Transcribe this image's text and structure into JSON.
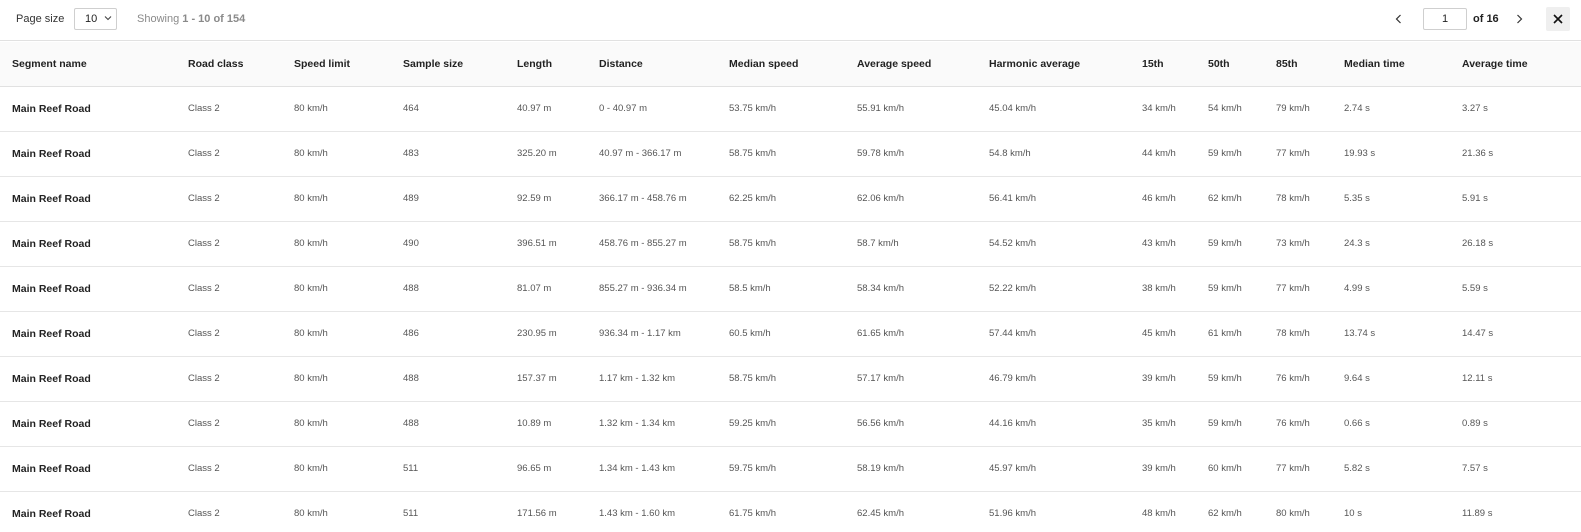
{
  "toolbar": {
    "page_size_label": "Page size",
    "page_size_value": "10",
    "showing_prefix": "Showing",
    "showing_range": "1 - 10 of 154",
    "current_page": "1",
    "of_pages": "of 16"
  },
  "icons": {
    "page_size_dropdown": "chevron-down-icon",
    "prev": "chevron-left-icon",
    "next": "chevron-right-icon",
    "close": "close-icon"
  },
  "table": {
    "columns": [
      "Segment name",
      "Road class",
      "Speed limit",
      "Sample size",
      "Length",
      "Distance",
      "Median speed",
      "Average speed",
      "Harmonic average",
      "15th",
      "50th",
      "85th",
      "Median time",
      "Average time"
    ],
    "rows": [
      [
        "Main Reef Road",
        "Class 2",
        "80 km/h",
        "464",
        "40.97 m",
        "0 - 40.97 m",
        "53.75 km/h",
        "55.91 km/h",
        "45.04 km/h",
        "34 km/h",
        "54 km/h",
        "79 km/h",
        "2.74 s",
        "3.27 s"
      ],
      [
        "Main Reef Road",
        "Class 2",
        "80 km/h",
        "483",
        "325.20 m",
        "40.97 m - 366.17 m",
        "58.75 km/h",
        "59.78 km/h",
        "54.8 km/h",
        "44 km/h",
        "59 km/h",
        "77 km/h",
        "19.93 s",
        "21.36 s"
      ],
      [
        "Main Reef Road",
        "Class 2",
        "80 km/h",
        "489",
        "92.59 m",
        "366.17 m - 458.76 m",
        "62.25 km/h",
        "62.06 km/h",
        "56.41 km/h",
        "46 km/h",
        "62 km/h",
        "78 km/h",
        "5.35 s",
        "5.91 s"
      ],
      [
        "Main Reef Road",
        "Class 2",
        "80 km/h",
        "490",
        "396.51 m",
        "458.76 m - 855.27 m",
        "58.75 km/h",
        "58.7 km/h",
        "54.52 km/h",
        "43 km/h",
        "59 km/h",
        "73 km/h",
        "24.3 s",
        "26.18 s"
      ],
      [
        "Main Reef Road",
        "Class 2",
        "80 km/h",
        "488",
        "81.07 m",
        "855.27 m - 936.34 m",
        "58.5 km/h",
        "58.34 km/h",
        "52.22 km/h",
        "38 km/h",
        "59 km/h",
        "77 km/h",
        "4.99 s",
        "5.59 s"
      ],
      [
        "Main Reef Road",
        "Class 2",
        "80 km/h",
        "486",
        "230.95 m",
        "936.34 m - 1.17 km",
        "60.5 km/h",
        "61.65 km/h",
        "57.44 km/h",
        "45 km/h",
        "61 km/h",
        "78 km/h",
        "13.74 s",
        "14.47 s"
      ],
      [
        "Main Reef Road",
        "Class 2",
        "80 km/h",
        "488",
        "157.37 m",
        "1.17 km - 1.32 km",
        "58.75 km/h",
        "57.17 km/h",
        "46.79 km/h",
        "39 km/h",
        "59 km/h",
        "76 km/h",
        "9.64 s",
        "12.11 s"
      ],
      [
        "Main Reef Road",
        "Class 2",
        "80 km/h",
        "488",
        "10.89 m",
        "1.32 km - 1.34 km",
        "59.25 km/h",
        "56.56 km/h",
        "44.16 km/h",
        "35 km/h",
        "59 km/h",
        "76 km/h",
        "0.66 s",
        "0.89 s"
      ],
      [
        "Main Reef Road",
        "Class 2",
        "80 km/h",
        "511",
        "96.65 m",
        "1.34 km - 1.43 km",
        "59.75 km/h",
        "58.19 km/h",
        "45.97 km/h",
        "39 km/h",
        "60 km/h",
        "77 km/h",
        "5.82 s",
        "7.57 s"
      ],
      [
        "Main Reef Road",
        "Class 2",
        "80 km/h",
        "511",
        "171.56 m",
        "1.43 km - 1.60 km",
        "61.75 km/h",
        "62.45 km/h",
        "51.96 km/h",
        "48 km/h",
        "62 km/h",
        "80 km/h",
        "10 s",
        "11.89 s"
      ]
    ]
  }
}
